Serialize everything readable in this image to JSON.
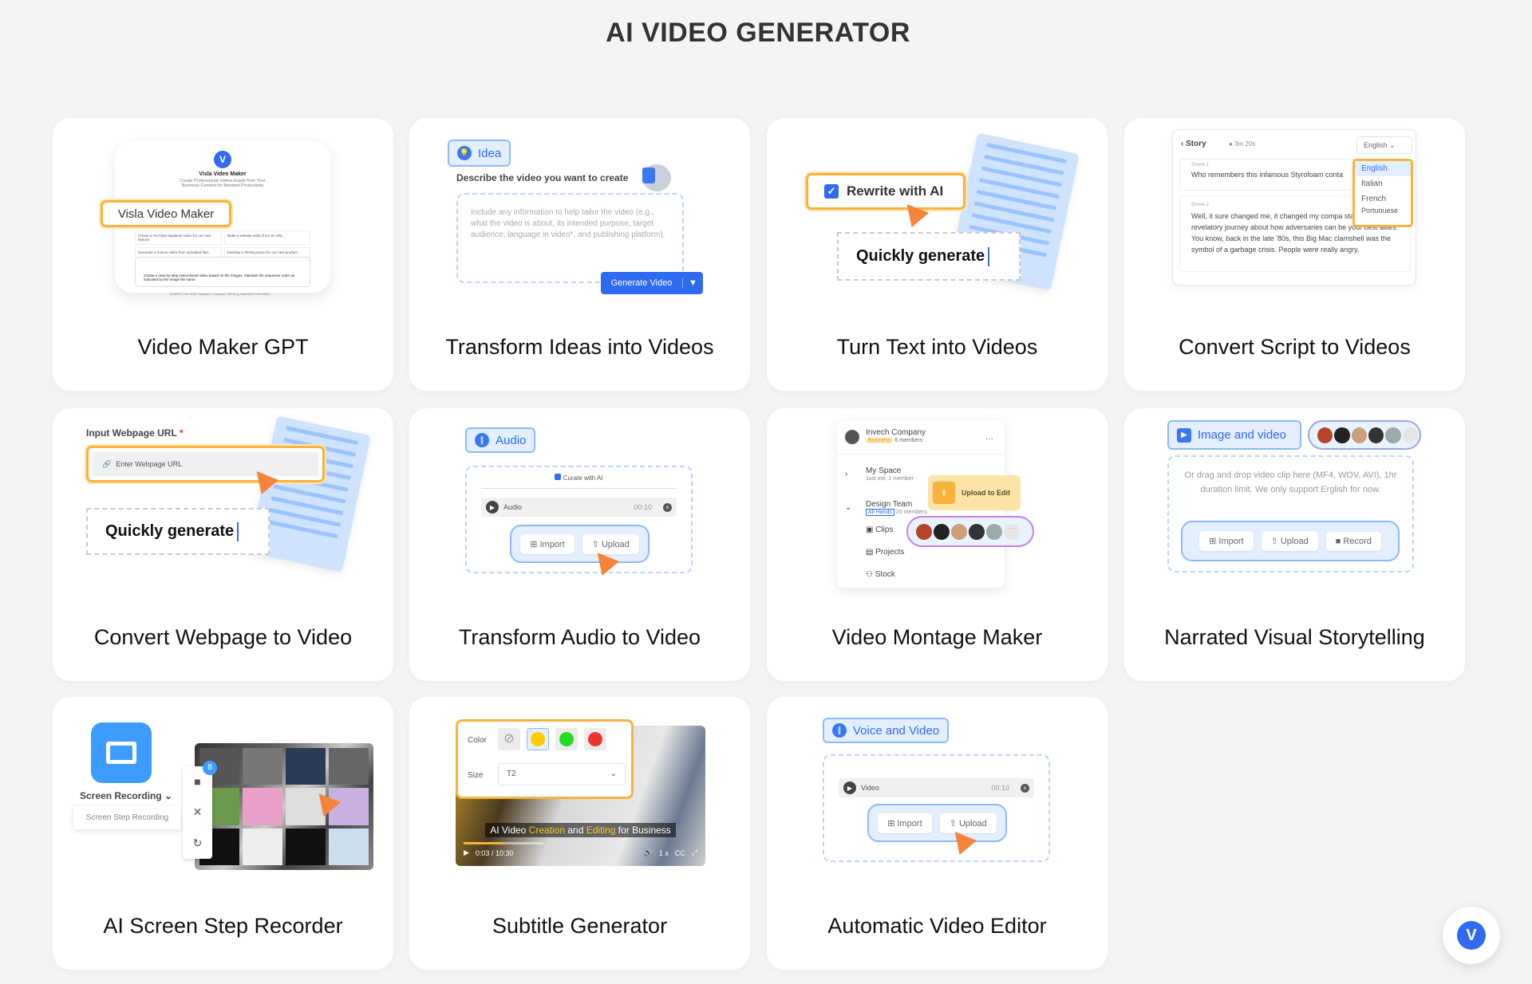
{
  "page": {
    "title": "AI VIDEO GENERATOR"
  },
  "colors": {
    "accent": "#2f6bf0",
    "highlight": "#f7b33b",
    "cursor": "#f5833a",
    "chip_bg": "#e3efff"
  },
  "cards": [
    {
      "label": "Video Maker GPT",
      "preview": {
        "app_name": "Visla Video Maker",
        "tagline": "Create Professional Videos Easily from Your Business Content for Boosted Productivity",
        "badge": "Visla Video Maker",
        "suggestions": [
          "Create a YouTube explainer video for our new feature.",
          "Make a website video from an URL.",
          "Generate a how-to video from uploaded files.",
          "Develop a TikTok promo for our new product."
        ],
        "prompt": "Create a step-by-step instructional video based on the images. Maintain the sequence order as indicated by the image file name.",
        "footer": "ChatGPT can make mistakes. Consider checking important information."
      }
    },
    {
      "label": "Transform Ideas into Videos",
      "preview": {
        "chip": "Idea",
        "prompt_label": "Describe the video you want to create",
        "placeholder": "Include any information to help tailor the video (e.g., what the video is about,  its intended purpose, target audience, language in video*, and publishing platform).",
        "button": "Generate Video"
      }
    },
    {
      "label": "Turn Text into Videos",
      "preview": {
        "checkbox": "Rewrite with AI",
        "input": "Quickly generate"
      }
    },
    {
      "label": "Convert Script to Videos",
      "preview": {
        "back": "Story",
        "duration": "3m 20s",
        "language": "English",
        "languages": [
          "English",
          "Italian",
          "French",
          "Portuguese"
        ],
        "scene1_label": "Scene 1",
        "scene1_text": "Who remembers this infamous Styrofoam conta",
        "scene2_label": "Scene 2",
        "scene2_text": "Well, it sure changed me, it changed my compa started a revelatory journey about how adversaries can be your best allies.   You know, back in the late '80s, this Big Mac clamshell was the symbol of a garbage crisis. People were really angry."
      }
    },
    {
      "label": "Convert Webpage to Video",
      "preview": {
        "field_label": "Input Webpage URL",
        "required": "*",
        "placeholder": "Enter Webpage URL",
        "input": "Quickly generate"
      }
    },
    {
      "label": "Transform Audio to Video",
      "preview": {
        "chip": "Audio",
        "checkbox": "Curate with AI",
        "track": "Audio",
        "time": "00:10",
        "import": "Import",
        "upload": "Upload"
      }
    },
    {
      "label": "Video Montage Maker",
      "preview": {
        "company": "Invech Company",
        "plan": "Business",
        "company_members": "6 members",
        "space": "My Space",
        "space_members": "Just me, 1 member",
        "team": "Design Team",
        "team_tag": "All Hands",
        "team_members": "20 members",
        "items": [
          "Clips",
          "Projects",
          "Stock"
        ],
        "upload": "Upload to Edit"
      }
    },
    {
      "label": "Narrated Visual Storytelling",
      "preview": {
        "chip": "Image and video",
        "hint": "Or drag and drop video clip here (MF4, WOV, AVI), 1hr duration limit. We only support Erglish for now.",
        "import": "Import",
        "upload": "Upload",
        "record": "Record"
      }
    },
    {
      "label": "AI Screen Step Recorder",
      "preview": {
        "menu": "Screen Recording",
        "option": "Screen Step Recording",
        "badge": "8"
      }
    },
    {
      "label": "Subtitle Generator",
      "preview": {
        "color_label": "Color",
        "size_label": "Size",
        "size_value": "T2",
        "subtitle_pre": "AI Video ",
        "subtitle_h1": "Creation",
        "subtitle_mid": " and ",
        "subtitle_h2": "Editing",
        "subtitle_post": " for Business",
        "time": "0:03 / 10:30",
        "speed": "1 x",
        "swatches": [
          "none",
          "#ffcc00",
          "#22dd22",
          "#ee3333"
        ],
        "progress": 0.5
      }
    },
    {
      "label": "Automatic Video Editor",
      "preview": {
        "chip": "Voice and Video",
        "track": "Video",
        "time": "00:10",
        "import": "Import",
        "upload": "Upload"
      }
    }
  ]
}
